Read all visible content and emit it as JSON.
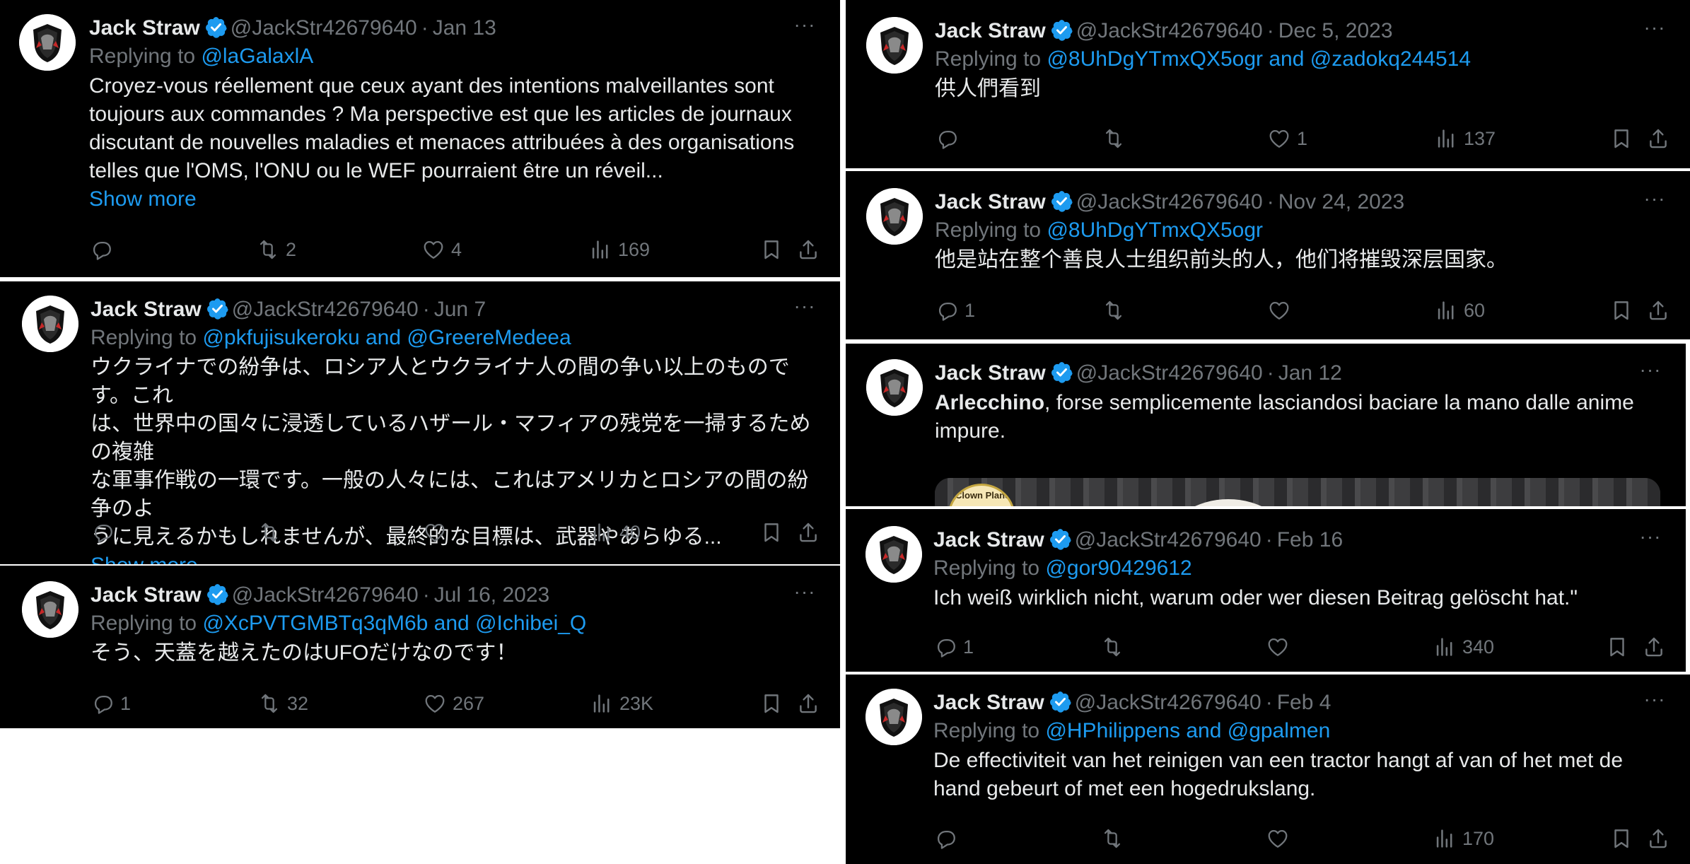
{
  "author": {
    "name": "Jack Straw",
    "handle": "@JackStr42679640",
    "dot": "·"
  },
  "labels": {
    "replying_to": "Replying to",
    "and": "and",
    "show_more": "Show more",
    "more_menu": "···"
  },
  "icons": {
    "reply": "reply-icon",
    "retweet": "retweet-icon",
    "like": "heart-icon",
    "views": "views-icon",
    "bookmark": "bookmark-icon",
    "share": "share-icon",
    "verified": "verified-badge-icon"
  },
  "colors": {
    "background": "#000000",
    "text": "#e7e9ea",
    "muted": "#71767b",
    "accent": "#1d9bf0"
  },
  "tweets": [
    {
      "date": "Jan 13",
      "mentions": [
        "@laGalaxlA"
      ],
      "text": "Croyez-vous réellement que ceux ayant des intentions malveillantes sont\ntoujours aux commandes ? Ma perspective est que les articles de journaux\ndiscutant de nouvelles maladies et menaces attribuées à des organisations\ntelles que l'OMS, l'ONU ou le WEF pourraient être un réveil...",
      "show_more": true,
      "replies": "",
      "retweets": "2",
      "likes": "4",
      "views": "169"
    },
    {
      "date": "Jun 7",
      "mentions": [
        "@pkfujisukeroku",
        "@GreereMedeea"
      ],
      "text": "ウクライナでの紛争は、ロシア人とウクライナ人の間の争い以上のものです。これ\nは、世界中の国々に浸透しているハザール・マフィアの残党を一掃するための複雑\nな軍事作戦の一環です。一般の人々には、これはアメリカとロシアの間の紛争のよ\nうに見えるかもしれませんが、最終的な目標は、武器やあらゆる...",
      "show_more": true,
      "replies": "",
      "retweets": "",
      "likes": "",
      "views": "40"
    },
    {
      "date": "Jul 16, 2023",
      "mentions": [
        "@XcPVTGMBTq3qM6b",
        "@Ichibei_Q"
      ],
      "text": "そう、天蓋を越えたのはUFOだけなのです！",
      "show_more": false,
      "replies": "1",
      "retweets": "32",
      "likes": "267",
      "views": "23K"
    },
    {
      "date": "Dec 5, 2023",
      "mentions": [
        "@8UhDgYTmxQX5ogr",
        "@zadokq244514"
      ],
      "text": "供人們看到",
      "show_more": false,
      "replies": "",
      "retweets": "",
      "likes": "1",
      "views": "137"
    },
    {
      "date": "Nov 24, 2023",
      "mentions": [
        "@8UhDgYTmxQX5ogr"
      ],
      "text": "他是站在整个善良人士组织前头的人，他们将摧毁深层国家。",
      "show_more": false,
      "replies": "1",
      "retweets": "",
      "likes": "",
      "views": "60"
    },
    {
      "date": "Jan 12",
      "mentions": [],
      "text_bold": "Arlecchino",
      "text": ", forse semplicemente lasciandosi baciare la mano dalle anime\nimpure.",
      "media_label": "Clown Planet",
      "show_more": false
    },
    {
      "date": "Feb 16",
      "mentions": [
        "@gor90429612"
      ],
      "text": "Ich weiß wirklich nicht, warum oder wer diesen Beitrag gelöscht hat.\"",
      "show_more": false,
      "replies": "1",
      "retweets": "",
      "likes": "",
      "views": "340"
    },
    {
      "date": "Feb 4",
      "mentions": [
        "@HPhilippens",
        "@gpalmen"
      ],
      "text": "De effectiviteit van het reinigen van een tractor hangt af van of het met de\nhand gebeurt of met een hogedrukslang.",
      "show_more": false,
      "replies": "",
      "retweets": "",
      "likes": "",
      "views": "170"
    }
  ]
}
